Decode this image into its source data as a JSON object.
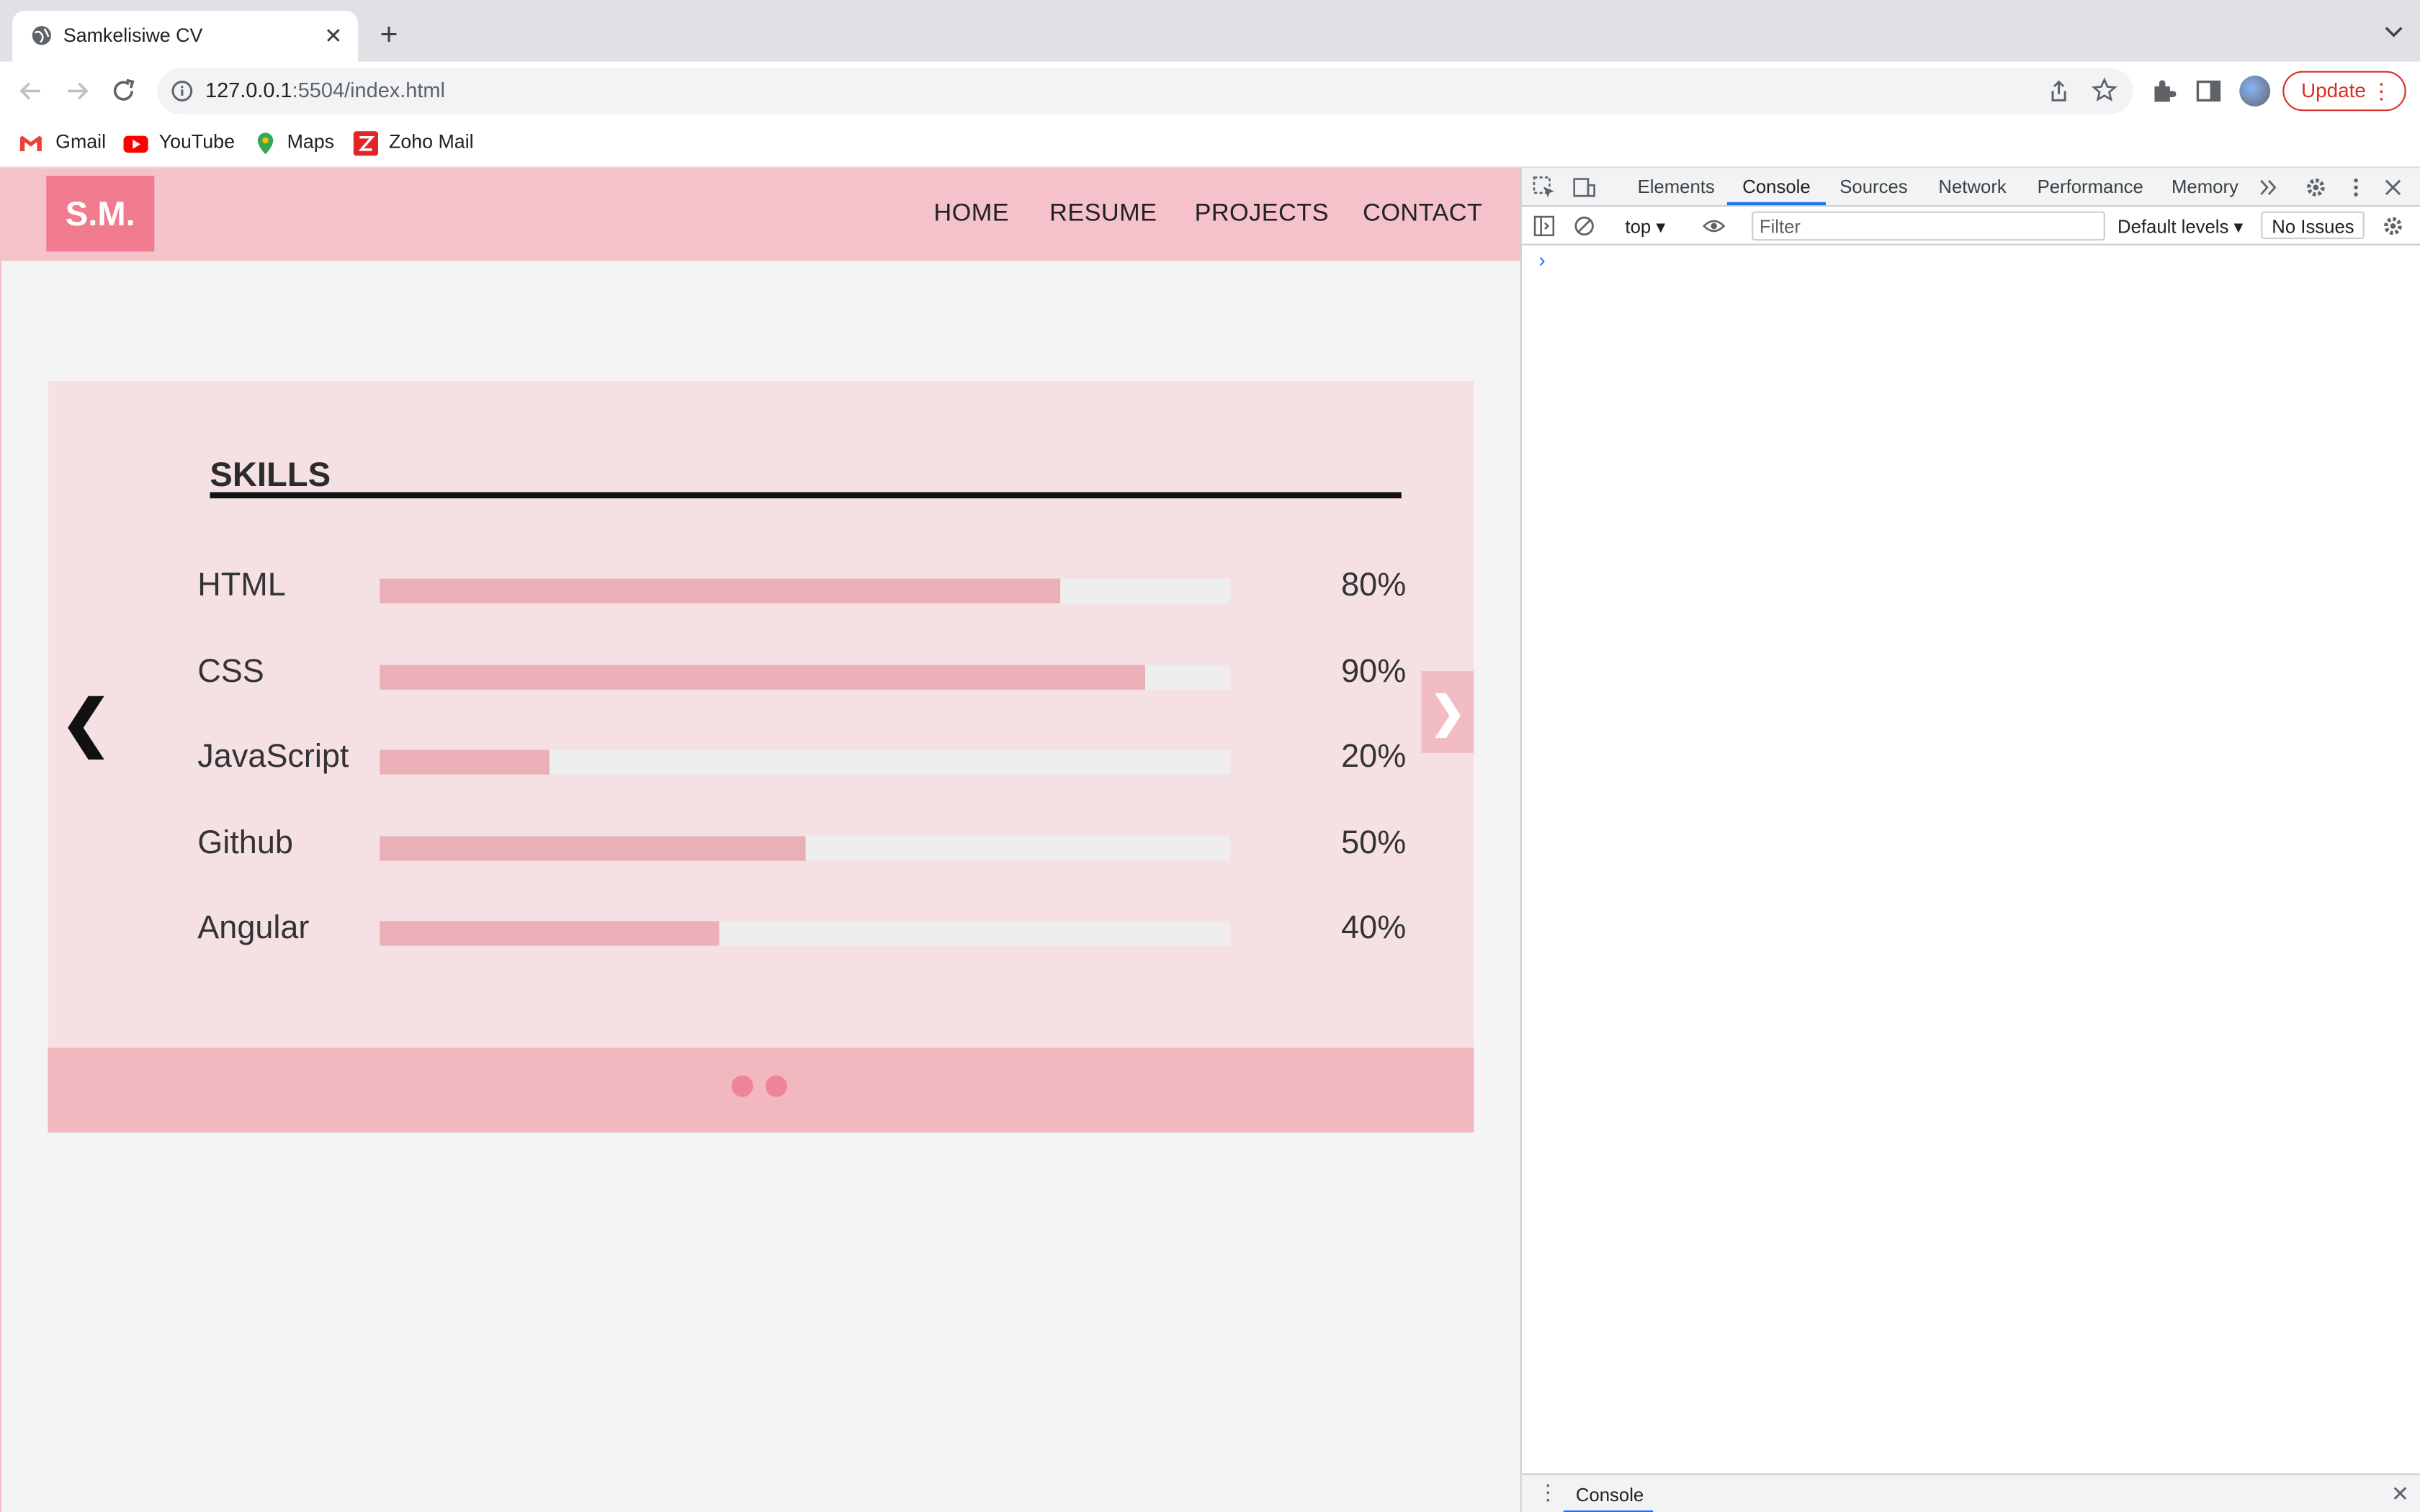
{
  "browser": {
    "tab_title": "Samkelisiwe CV",
    "tab_close": "✕",
    "new_tab": "+",
    "url_host": "127.0.0.1",
    "url_path": ":5504/index.html",
    "update_label": "Update",
    "update_menu": "⋮",
    "bookmarks": [
      "Gmail",
      "YouTube",
      "Maps",
      "Zoho Mail"
    ]
  },
  "site": {
    "logo": "S.M.",
    "nav": [
      "HOME",
      "RESUME",
      "PROJECTS",
      "CONTACT"
    ],
    "section_title": "SKILLS",
    "prev_arrow": "❮",
    "next_arrow": "❯",
    "skills": [
      {
        "name": "HTML",
        "percent_label": "80%",
        "level": 0.8
      },
      {
        "name": "CSS",
        "percent_label": "90%",
        "level": 0.9
      },
      {
        "name": "JavaScript",
        "percent_label": "20%",
        "level": 0.2
      },
      {
        "name": "Github",
        "percent_label": "50%",
        "level": 0.5
      },
      {
        "name": "Angular",
        "percent_label": "40%",
        "level": 0.4
      }
    ],
    "slide_dots": 2
  },
  "devtools": {
    "tabs": [
      "Elements",
      "Console",
      "Sources",
      "Network",
      "Performance",
      "Memory"
    ],
    "active_tab": "Console",
    "context": "top",
    "filter_placeholder": "Filter",
    "levels": "Default levels",
    "issues": "No Issues",
    "prompt": "›",
    "drawer_tab": "Console",
    "drawer_menu": "⋮",
    "drawer_close": "✕"
  },
  "colors": {
    "header_pink": "#f5c2cb",
    "logo_pink": "#f07b8f",
    "bar_fill": "#ebb0b7",
    "update_red": "#d93025",
    "devtools_accent": "#1a73e8"
  }
}
